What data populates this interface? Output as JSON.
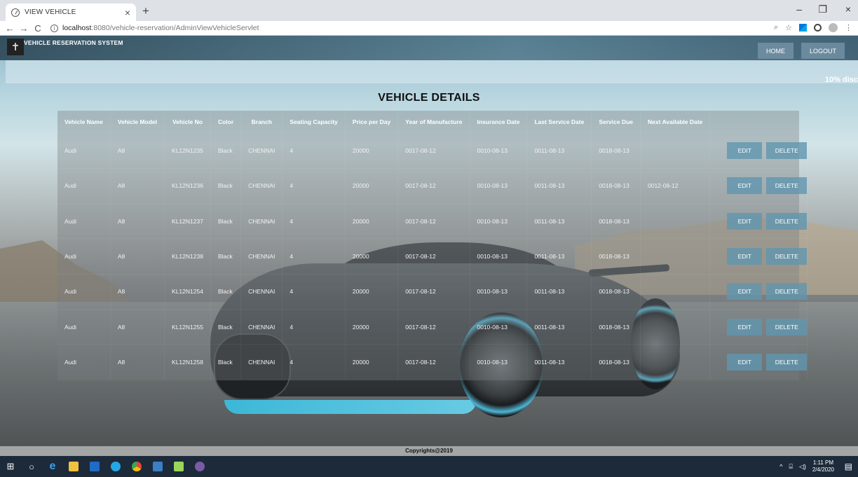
{
  "browser": {
    "tab_title": "VIEW VEHICLE",
    "tab_close": "×",
    "new_tab": "+",
    "url_host": "localhost",
    "url_path": ":8080/vehicle-reservation/AdminViewVehicleServlet",
    "minimize": "–",
    "restore": "❐",
    "close": "×"
  },
  "site": {
    "brand": "VEHICLE RESERVATION SYSTEM",
    "nav": {
      "home": "HOME",
      "logout": "LOGOUT"
    },
    "marquee": "10% disc",
    "heading": "VEHICLE DETAILS",
    "footer": "Copyrights@2019"
  },
  "table": {
    "headers": [
      "Vehicle Name",
      "Vehicle Model",
      "Vehicle No",
      "Color",
      "Branch",
      "Seating Capacity",
      "Price per Day",
      "Year of Manufacture",
      "Insurance Date",
      "Last Service Date",
      "Service Due",
      "Next Available Date"
    ],
    "rows": [
      [
        "Audi",
        "A8",
        "KL12N1235",
        "Black",
        "CHENNAI",
        "4",
        "20000",
        "0017-08-12",
        "0010-08-13",
        "0011-08-13",
        "0018-08-13",
        ""
      ],
      [
        "Audi",
        "A8",
        "KL12N1236",
        "Black",
        "CHENNAI",
        "4",
        "20000",
        "0017-08-12",
        "0010-08-13",
        "0011-08-13",
        "0018-08-13",
        "0012-08-12"
      ],
      [
        "Audi",
        "A8",
        "KL12N1237",
        "Black",
        "CHENNAI",
        "4",
        "20000",
        "0017-08-12",
        "0010-08-13",
        "0011-08-13",
        "0018-08-13",
        ""
      ],
      [
        "Audi",
        "A8",
        "KL12N1238",
        "Black",
        "CHENNAI",
        "4",
        "20000",
        "0017-08-12",
        "0010-08-13",
        "0011-08-13",
        "0018-08-13",
        ""
      ],
      [
        "Audi",
        "A8",
        "KL12N1254",
        "Black",
        "CHENNAI",
        "4",
        "20000",
        "0017-08-12",
        "0010-08-13",
        "0011-08-13",
        "0018-08-13",
        ""
      ],
      [
        "Audi",
        "A8",
        "KL12N1255",
        "Black",
        "CHENNAI",
        "4",
        "20000",
        "0017-08-12",
        "0010-08-13",
        "0011-08-13",
        "0018-08-13",
        ""
      ],
      [
        "Audi",
        "A8",
        "KL12N1258",
        "Black",
        "CHENNAI",
        "4",
        "20000",
        "0017-08-12",
        "0010-08-13",
        "0011-08-13",
        "0018-08-13",
        ""
      ]
    ],
    "edit_label": "EDIT",
    "delete_label": "DELETE"
  },
  "taskbar": {
    "time": "1:11 PM",
    "date": "2/4/2020"
  },
  "colors": {
    "button_bg": "#6096af",
    "header_bg": "#284d63",
    "taskbar_bg": "#1c2a3a"
  }
}
